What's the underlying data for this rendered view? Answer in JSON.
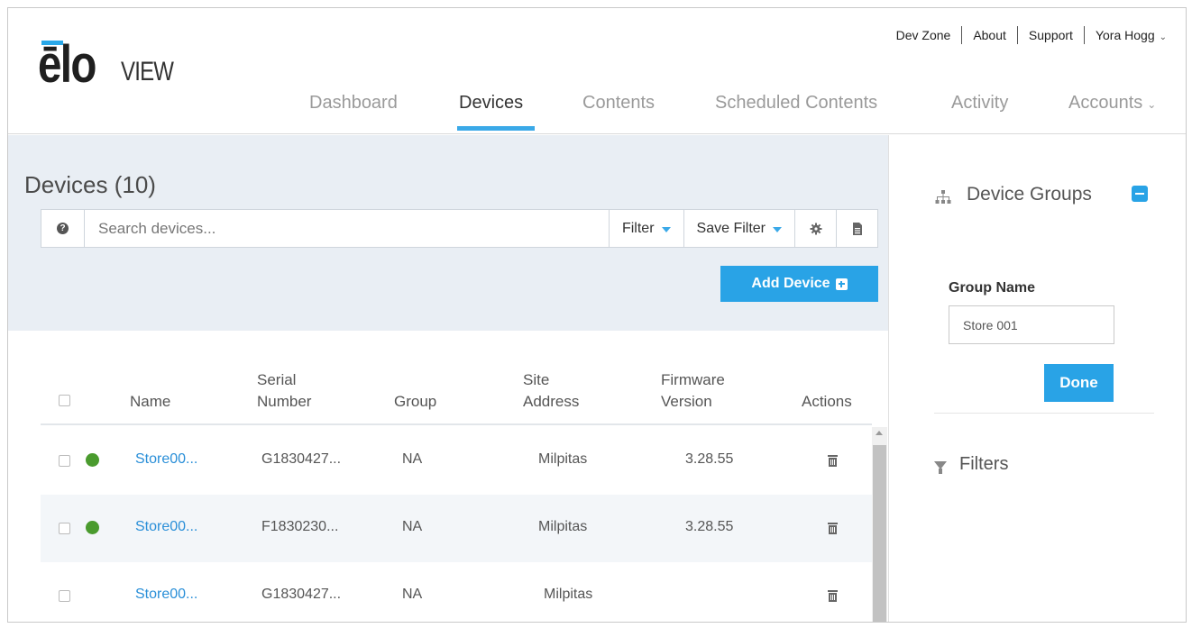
{
  "brand": {
    "logo_main": "ēlo",
    "logo_sub": "VIEW"
  },
  "header": {
    "links": {
      "dev_zone": "Dev Zone",
      "about": "About",
      "support": "Support",
      "user": "Yora Hogg"
    },
    "nav": {
      "dashboard": "Dashboard",
      "devices": "Devices",
      "contents": "Contents",
      "scheduled": "Scheduled Contents",
      "activity": "Activity",
      "accounts": "Accounts"
    },
    "active_tab": "Devices"
  },
  "main": {
    "title": "Devices (10)",
    "search": {
      "placeholder": "Search devices...",
      "value": ""
    },
    "toolbar": {
      "filter": "Filter",
      "save_filter": "Save Filter"
    },
    "add_device": "Add Device",
    "table": {
      "columns": {
        "name": "Name",
        "serial": "Serial\nNumber",
        "group": "Group",
        "site": "Site\nAddress",
        "firmware": "Firmware\nVersion",
        "actions": "Actions"
      },
      "rows": [
        {
          "name": "Store00...",
          "serial": "G1830427...",
          "group": "NA",
          "site": "Milpitas",
          "firmware": "3.28.55",
          "online": true
        },
        {
          "name": "Store00...",
          "serial": "F1830230...",
          "group": "NA",
          "site": "Milpitas",
          "firmware": "3.28.55",
          "online": true
        },
        {
          "name": "Store00...",
          "serial": "G1830427...",
          "group": "NA",
          "site": "Milpitas",
          "firmware": "",
          "online": false
        }
      ]
    }
  },
  "sidebar": {
    "device_groups": "Device Groups",
    "group_name_label": "Group Name",
    "group_name_value": "Store 001",
    "done": "Done",
    "filters": "Filters"
  },
  "colors": {
    "accent": "#29a3e6",
    "status_online": "#4a9b2e",
    "link": "#2a8fd8",
    "toolbar_bg": "#e9eef4"
  }
}
